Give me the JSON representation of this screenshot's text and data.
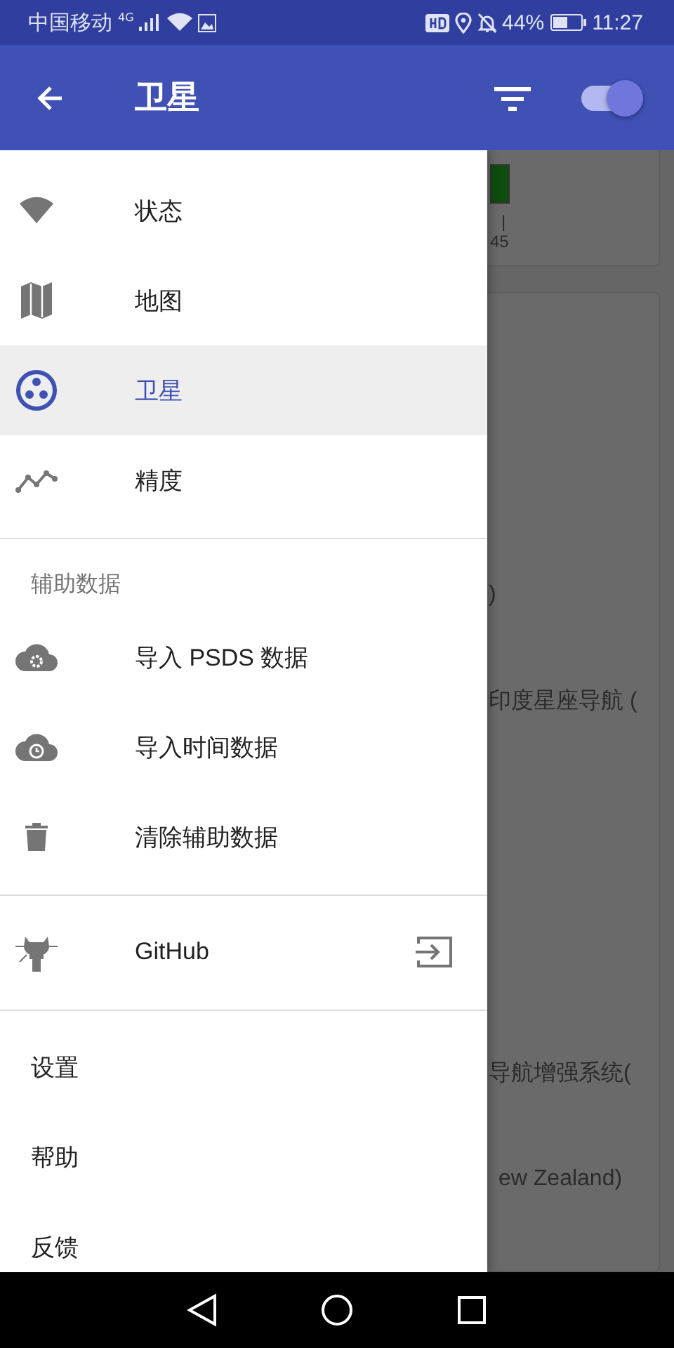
{
  "status_bar": {
    "carrier": "中国移动",
    "network": "4G",
    "battery": "44%",
    "time": "11:27"
  },
  "app_bar": {
    "title": "卫星",
    "toggle_on": true
  },
  "background": {
    "texts": [
      "|",
      "45",
      ")",
      "印度星座导航 (",
      "导航增强系统(",
      "ew Zealand)"
    ]
  },
  "drawer": {
    "sections": [
      {
        "items": [
          {
            "label": "状态",
            "selected": false
          },
          {
            "label": "地图",
            "selected": false
          },
          {
            "label": "卫星",
            "selected": true
          },
          {
            "label": "精度",
            "selected": false
          }
        ]
      },
      {
        "header": "辅助数据",
        "items": [
          {
            "label": "导入 PSDS 数据",
            "selected": false
          },
          {
            "label": "导入时间数据",
            "selected": false
          },
          {
            "label": "清除辅助数据",
            "selected": false
          }
        ]
      },
      {
        "items": [
          {
            "label": "GitHub",
            "selected": false,
            "external": true
          }
        ]
      },
      {
        "items": [
          {
            "label": "设置",
            "selected": false
          },
          {
            "label": "帮助",
            "selected": false
          },
          {
            "label": "反馈",
            "selected": false
          }
        ]
      }
    ]
  }
}
